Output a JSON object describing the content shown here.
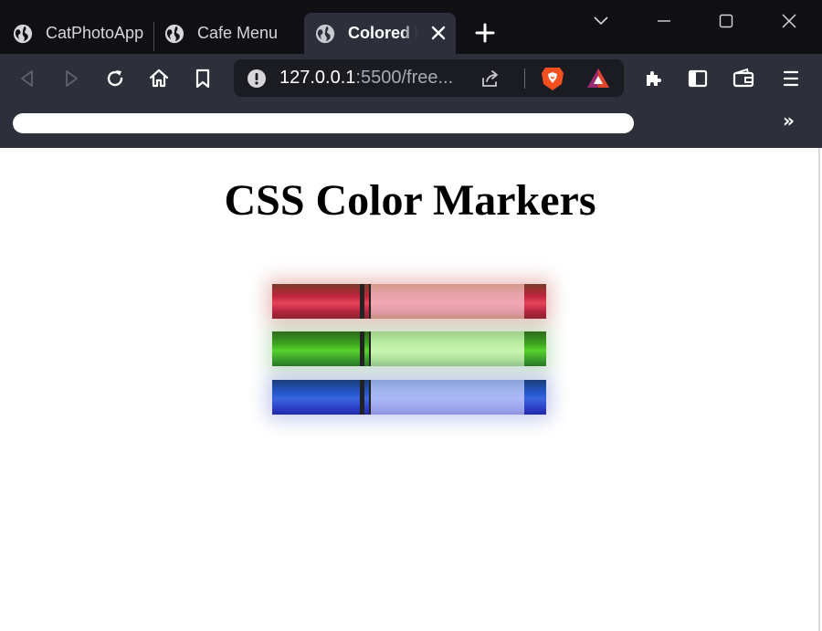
{
  "browser": {
    "tabs": [
      {
        "label": "CatPhotoApp",
        "icon": "globe-icon"
      },
      {
        "label": "Cafe Menu",
        "icon": "globe-icon"
      },
      {
        "label": "Colored Markers",
        "icon": "globe-icon",
        "active": true
      }
    ],
    "url": {
      "host": "127.0.0.1",
      "rest": ":5500/free..."
    },
    "bookmarks_more": "»"
  },
  "page": {
    "title": "CSS Color Markers",
    "markers": [
      {
        "name": "red",
        "color": "#c0243c"
      },
      {
        "name": "green",
        "color": "#3ca41e"
      },
      {
        "name": "blue",
        "color": "#2456c8"
      }
    ]
  }
}
